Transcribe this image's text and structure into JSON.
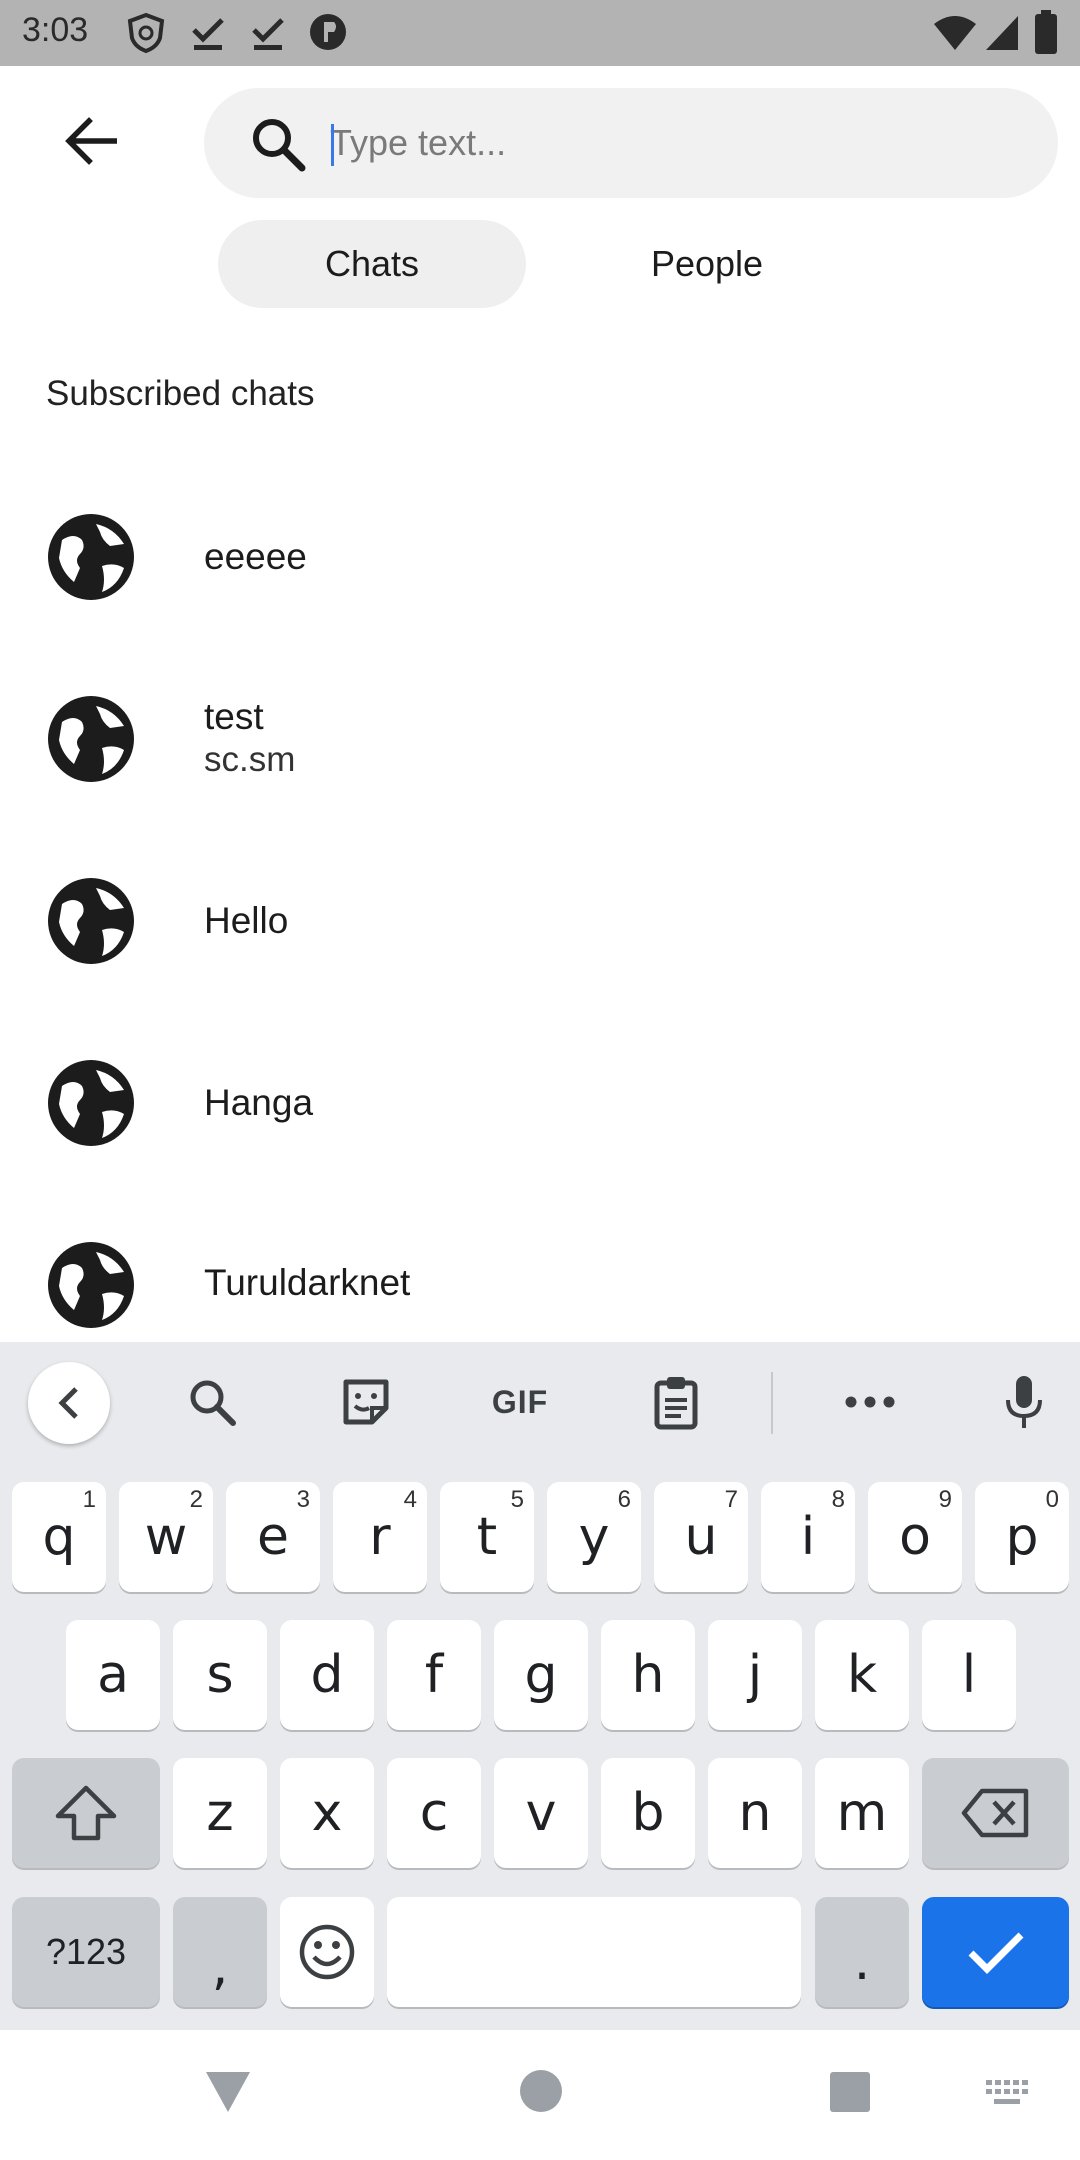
{
  "status_bar": {
    "time": "3:03",
    "left_icons": [
      "vpn-shield-icon",
      "download-check-icon",
      "download-check-icon",
      "app-circle-icon"
    ],
    "right_icons": [
      "wifi-icon",
      "signal-icon",
      "battery-icon"
    ]
  },
  "header": {
    "search_placeholder": "Type text...",
    "search_value": ""
  },
  "tabs": [
    {
      "label": "Chats",
      "selected": true
    },
    {
      "label": "People",
      "selected": false
    }
  ],
  "section": {
    "title": "Subscribed chats"
  },
  "chats": [
    {
      "name": "eeeee",
      "subtitle": ""
    },
    {
      "name": "test",
      "subtitle": "sc.sm"
    },
    {
      "name": "Hello",
      "subtitle": ""
    },
    {
      "name": "Hanga",
      "subtitle": ""
    },
    {
      "name": "Turuldarknet",
      "subtitle": ""
    }
  ],
  "keyboard": {
    "toolbar": [
      "collapse-icon",
      "search-icon",
      "sticker-icon",
      "gif-label",
      "clipboard-icon",
      "more-icon",
      "mic-icon"
    ],
    "gif_label": "GIF",
    "row1": [
      {
        "key": "q",
        "hint": "1"
      },
      {
        "key": "w",
        "hint": "2"
      },
      {
        "key": "e",
        "hint": "3"
      },
      {
        "key": "r",
        "hint": "4"
      },
      {
        "key": "t",
        "hint": "5"
      },
      {
        "key": "y",
        "hint": "6"
      },
      {
        "key": "u",
        "hint": "7"
      },
      {
        "key": "i",
        "hint": "8"
      },
      {
        "key": "o",
        "hint": "9"
      },
      {
        "key": "p",
        "hint": "0"
      }
    ],
    "row2": [
      "a",
      "s",
      "d",
      "f",
      "g",
      "h",
      "j",
      "k",
      "l"
    ],
    "row3": [
      "z",
      "x",
      "c",
      "v",
      "b",
      "n",
      "m"
    ],
    "sym_label": "?123",
    "comma": ",",
    "period": ".",
    "accent_color": "#1a73e8"
  }
}
